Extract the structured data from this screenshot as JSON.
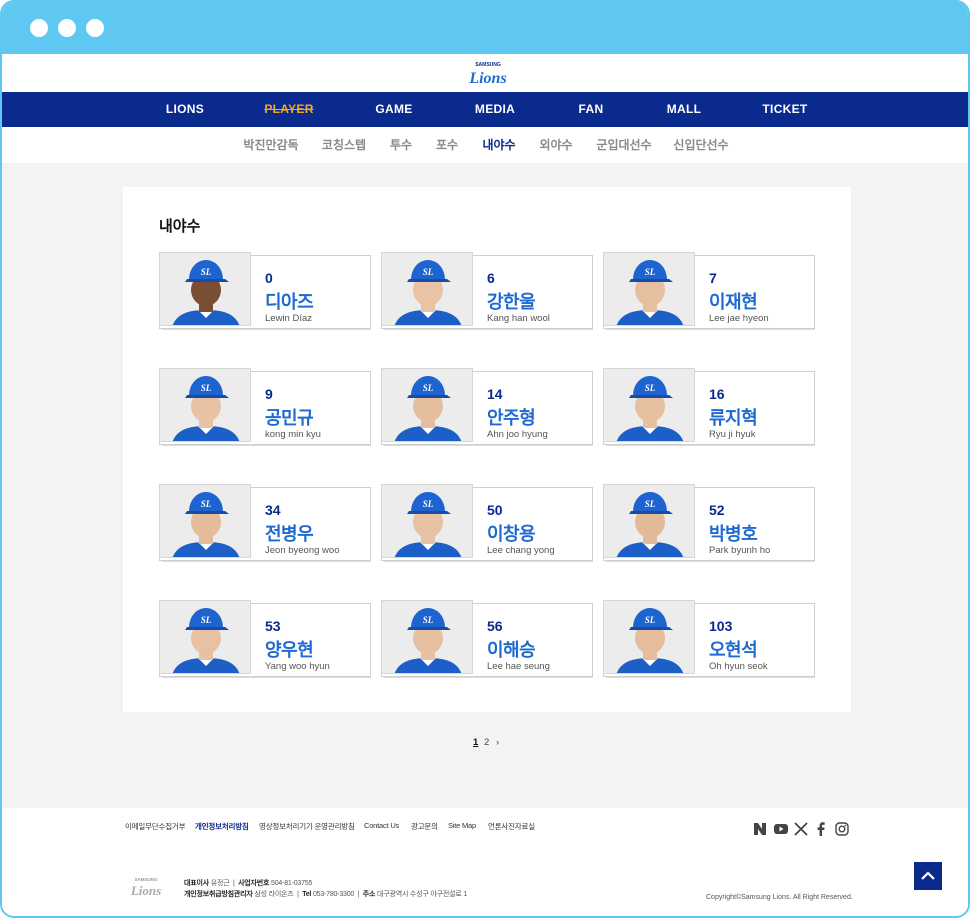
{
  "site": {
    "logo_small": "SAMSUNG",
    "logo_main": "Lions"
  },
  "gnb": [
    {
      "label": "LIONS"
    },
    {
      "label": "PLAYER"
    },
    {
      "label": "GAME"
    },
    {
      "label": "MEDIA"
    },
    {
      "label": "FAN"
    },
    {
      "label": "MALL"
    },
    {
      "label": "TICKET"
    }
  ],
  "lnb": [
    {
      "label": "박진만감독"
    },
    {
      "label": "코칭스텝"
    },
    {
      "label": "투수"
    },
    {
      "label": "포수"
    },
    {
      "label": "내야수"
    },
    {
      "label": "외야수"
    },
    {
      "label": "군입대선수"
    },
    {
      "label": "신입단선수"
    }
  ],
  "section_title": "내야수",
  "players": [
    {
      "number": "0",
      "name_ko": "디아즈",
      "name_en": "Lewin Díaz"
    },
    {
      "number": "6",
      "name_ko": "강한울",
      "name_en": "Kang han wool"
    },
    {
      "number": "7",
      "name_ko": "이재현",
      "name_en": "Lee jae hyeon"
    },
    {
      "number": "9",
      "name_ko": "공민규",
      "name_en": "kong min kyu"
    },
    {
      "number": "14",
      "name_ko": "안주형",
      "name_en": "Ahn joo hyung"
    },
    {
      "number": "16",
      "name_ko": "류지혁",
      "name_en": "Ryu ji hyuk"
    },
    {
      "number": "34",
      "name_ko": "전병우",
      "name_en": "Jeon byeong woo"
    },
    {
      "number": "50",
      "name_ko": "이창용",
      "name_en": "Lee chang yong"
    },
    {
      "number": "52",
      "name_ko": "박병호",
      "name_en": "Park byunh ho"
    },
    {
      "number": "53",
      "name_ko": "양우현",
      "name_en": "Yang woo hyun"
    },
    {
      "number": "56",
      "name_ko": "이해승",
      "name_en": "Lee hae seung"
    },
    {
      "number": "103",
      "name_ko": "오현석",
      "name_en": "Oh hyun seok"
    }
  ],
  "cap_logo": "SL",
  "pagination": {
    "pages": [
      "1",
      "2"
    ],
    "current": "1",
    "next": "›"
  },
  "footer": {
    "links": [
      {
        "label": "이메일무단수집거부",
        "emphasis": false
      },
      {
        "label": "개인정보처리방침",
        "emphasis": true
      },
      {
        "label": "영상정보처리기기 운영관리방침",
        "emphasis": false
      },
      {
        "label": "Contact Us",
        "emphasis": false
      },
      {
        "label": "광고문의",
        "emphasis": false
      },
      {
        "label": "Site Map",
        "emphasis": false
      },
      {
        "label": "언론사진자료실",
        "emphasis": false
      }
    ],
    "social": [
      "naver-icon",
      "youtube-icon",
      "x-icon",
      "facebook-icon",
      "instagram-icon"
    ],
    "info_line1": {
      "ceo_label": "대표이사",
      "ceo": "유정근",
      "biz_label": "사업자번호",
      "biz": "504-81-03755"
    },
    "info_line2": {
      "privacy_label": "개인정보취급방침관리자",
      "privacy": "삼성 라이온즈",
      "tel_label": "Tel",
      "tel": "053-780-3300",
      "addr_label": "주소",
      "addr": "대구광역시 수성구 야구전설로 1"
    },
    "copyright": "Copyright©Samsung Lions. All Right Reserved."
  },
  "colors": {
    "frame": "#5ec8f2",
    "navy": "#0a2a8e",
    "player_name": "#1e6ad0",
    "active_menu": "#f5a623"
  }
}
